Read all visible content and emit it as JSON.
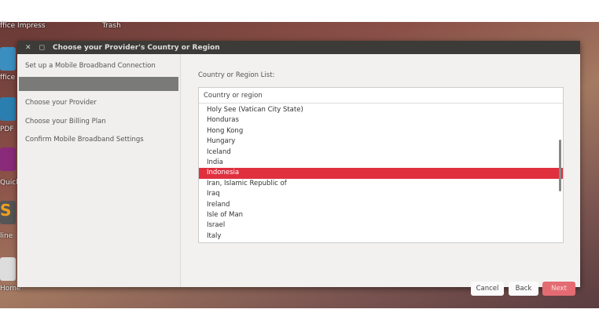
{
  "desktop": {
    "labels": [
      "ffice Impress",
      "Trash",
      "ffice",
      "PDF",
      "Quick",
      "line",
      "Home"
    ]
  },
  "dialog": {
    "title": "Choose your Provider's Country or Region",
    "steps": [
      "Set up a Mobile Broadband Connection",
      "Choose your Provider",
      "Choose your Billing Plan",
      "Confirm Mobile Broadband Settings"
    ],
    "list_label": "Country or Region List:",
    "list_header": "Country or region",
    "countries": [
      "Holy See (Vatican City State)",
      "Honduras",
      "Hong Kong",
      "Hungary",
      "Iceland",
      "India",
      "Indonesia",
      "Iran, Islamic Republic of",
      "Iraq",
      "Ireland",
      "Isle of Man",
      "Israel",
      "Italy"
    ],
    "selected": "Indonesia",
    "buttons": {
      "cancel": "Cancel",
      "back": "Back",
      "next": "Next"
    },
    "accent": "#e0303e"
  }
}
